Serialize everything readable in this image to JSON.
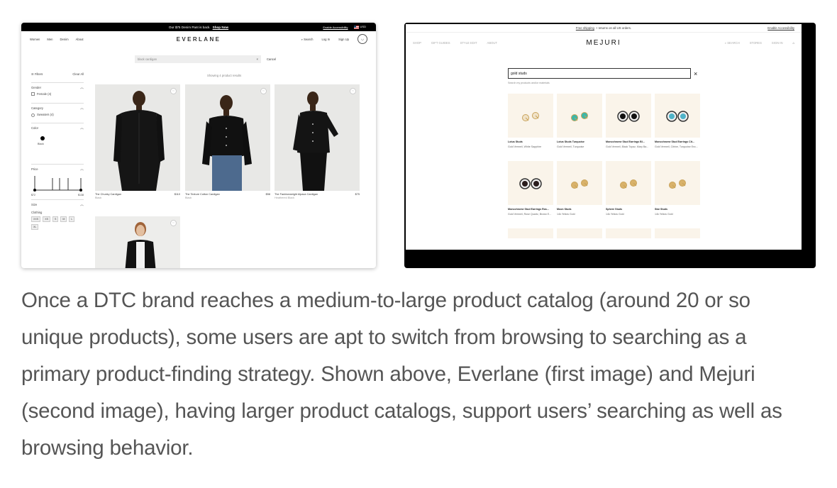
{
  "everlane": {
    "promo": {
      "text": "Our $75 Denim Pant is back.",
      "link": "Shop Now",
      "accessibility": "Enable Accessibility",
      "currency": "USD"
    },
    "nav": {
      "left": [
        "Women",
        "Men",
        "Denim",
        "About"
      ],
      "logo": "EVERLANE",
      "right": [
        "Search",
        "Log In",
        "Sign Up"
      ],
      "cart_icon": "bag-icon"
    },
    "search": {
      "value": "black cardigan",
      "clear": "×",
      "cancel": "Cancel"
    },
    "results_count": "Showing 4 product results",
    "filters": {
      "header": "Filters",
      "clear": "Clear All",
      "gender": {
        "title": "Gender",
        "option": "Female (4)"
      },
      "category": {
        "title": "Category",
        "option": "Sweaters (4)"
      },
      "color": {
        "title": "Color",
        "option": "Black"
      },
      "price": {
        "title": "Price",
        "min": "$72",
        "max": "$138"
      },
      "size": {
        "title": "Size",
        "group": "Clothing",
        "options": [
          "XXS",
          "XS",
          "S",
          "M",
          "L",
          "XL"
        ]
      }
    },
    "products": [
      {
        "name": "The Chunky Cardigan",
        "price": "$110",
        "color": "Black"
      },
      {
        "name": "The Texture Cotton Cardigan",
        "price": "$58",
        "color": "Black"
      },
      {
        "name": "The Fashionweight Alpaca Cardigan",
        "price": "$75",
        "color": "Heathered Black"
      },
      {
        "name": "",
        "price": "",
        "color": ""
      }
    ]
  },
  "mejuri": {
    "promo": {
      "link": "Free shipping",
      "text": "+ returns on all US orders.",
      "accessibility": "Enable Accessibility"
    },
    "nav": {
      "left": [
        "SHOP",
        "GIFT GUIDES",
        "STYLE EDIT",
        "ABOUT"
      ],
      "logo": "MEJURI",
      "right": [
        "SEARCH",
        "STORES",
        "SIGN IN"
      ],
      "cart_icon": "bag-icon"
    },
    "search": {
      "value": "gold studs",
      "close": "×",
      "hint": "Search my products and/or materials"
    },
    "products": [
      {
        "name": "Lotus Studs",
        "sub": "Gold Vermeil, White Sapphire",
        "stone": "#f0e2c8"
      },
      {
        "name": "Lotus Studs Turquoise",
        "sub": "Gold Vermeil, Turquoise",
        "stone": "#3cb7a8"
      },
      {
        "name": "Monochrome Stud Earrings Bl...",
        "sub": "Gold Vermeil, Black Topaz, Mary Ba...",
        "stone": "#111111"
      },
      {
        "name": "Monochrome Stud Earrings Cit...",
        "sub": "Gold Vermeil, Citrine, Turquoise Enc...",
        "stone": "#4fb3c9"
      },
      {
        "name": "Monochrome Stud Earrings Ros...",
        "sub": "Gold Vermeil, Rose Quartz, Brown E...",
        "stone": "#2a1d1d"
      },
      {
        "name": "Moon Studs",
        "sub": "14k Yellow Gold",
        "stone": "#d9b26a"
      },
      {
        "name": "Sphere Studs",
        "sub": "14k Yellow Gold",
        "stone": "#d9b26a"
      },
      {
        "name": "Star Studs",
        "sub": "14k Yellow Gold",
        "stone": "#d9b26a"
      }
    ]
  },
  "caption": "Once a DTC brand reaches a medium-to-large product catalog (around 20 or so unique products), some users are apt to switch from browsing to searching as a primary product-finding strategy. Shown above, Everlane (first image) and Mejuri (second image), having larger product catalogs, support users’ searching as well as browsing behavior."
}
